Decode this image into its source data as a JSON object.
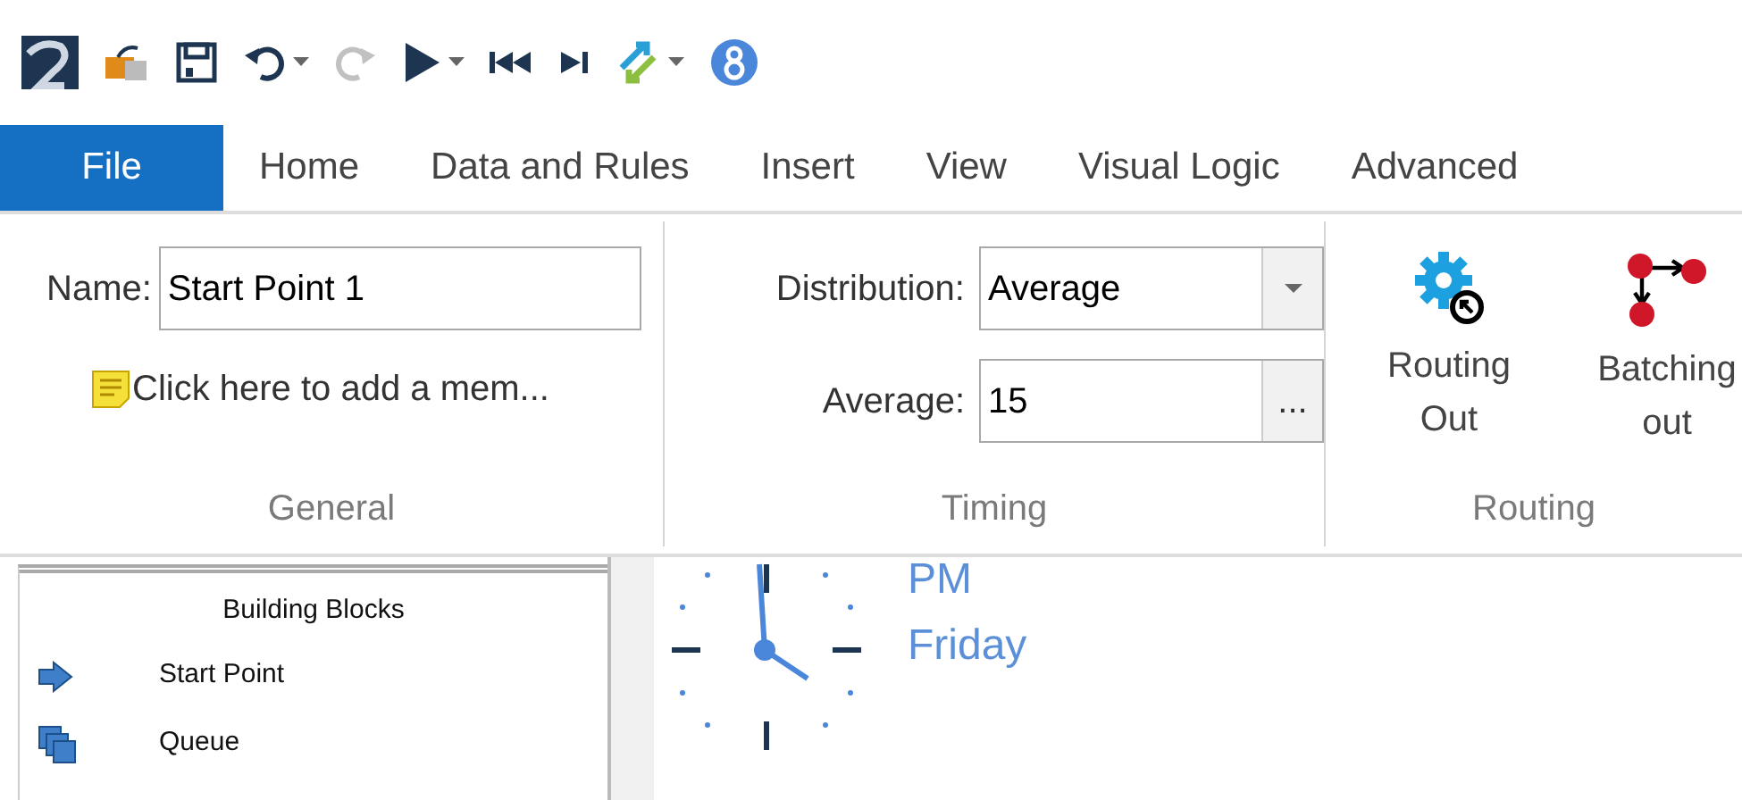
{
  "toolbar_buttons": [
    {
      "disabled": false,
      "dropdown": false
    },
    {
      "disabled": false,
      "dropdown": false
    },
    {
      "disabled": false,
      "dropdown": false
    },
    {
      "disabled": false,
      "dropdown": true
    },
    {
      "disabled": true,
      "dropdown": false
    },
    {
      "disabled": false,
      "dropdown": true
    },
    {
      "disabled": false,
      "dropdown": false
    },
    {
      "disabled": false,
      "dropdown": false
    },
    {
      "disabled": false,
      "dropdown": true
    },
    {
      "disabled": false,
      "dropdown": false
    }
  ],
  "tabs": [
    {
      "label": "File",
      "selected": true
    },
    {
      "label": "Home",
      "selected": false
    },
    {
      "label": "Data and Rules",
      "selected": false
    },
    {
      "label": "Insert",
      "selected": false
    },
    {
      "label": "View",
      "selected": false
    },
    {
      "label": "Visual Logic",
      "selected": false
    },
    {
      "label": "Advanced",
      "selected": false
    }
  ],
  "ribbon": {
    "general": {
      "title": "General",
      "name_label": "Name:",
      "name_value": "Start Point 1",
      "memo": "Click here to add a mem..."
    },
    "timing": {
      "title": "Timing",
      "distribution_label": "Distribution:",
      "distribution_value": "Average",
      "average_label": "Average:",
      "average_value": "15",
      "browse": "..."
    },
    "routing": {
      "title": "Routing",
      "buttons": [
        {
          "label": "Routing Out"
        },
        {
          "label": "Batching out"
        }
      ]
    }
  },
  "building_blocks": {
    "title": "Building Blocks",
    "items": [
      {
        "label": "Start Point"
      },
      {
        "label": "Queue"
      }
    ]
  },
  "canvas": {
    "clock_lines": [
      "PM",
      "Friday"
    ]
  }
}
